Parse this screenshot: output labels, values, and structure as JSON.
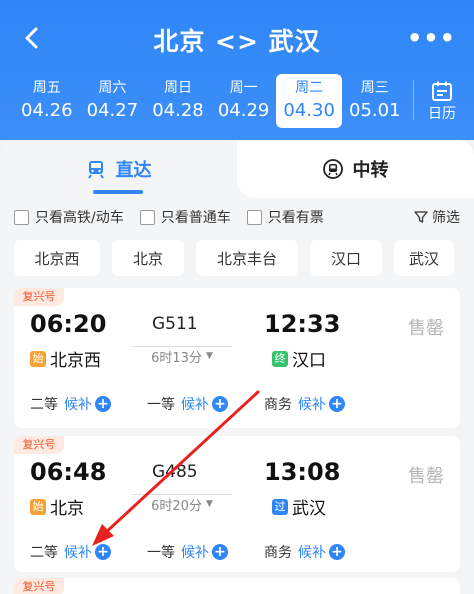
{
  "header": {
    "title": "北京 <> 武汉",
    "more": "•••",
    "calendar_label": "日历",
    "dates": [
      {
        "weekday": "周五",
        "date": "04.26"
      },
      {
        "weekday": "周六",
        "date": "04.27"
      },
      {
        "weekday": "周日",
        "date": "04.28"
      },
      {
        "weekday": "周一",
        "date": "04.29"
      },
      {
        "weekday": "周二",
        "date": "04.30"
      },
      {
        "weekday": "周三",
        "date": "05.01"
      }
    ],
    "active_date_index": 4
  },
  "tabs": {
    "direct": "直达",
    "transfer": "中转"
  },
  "filters": {
    "high_speed": "只看高铁/动车",
    "normal": "只看普通车",
    "available": "只看有票",
    "filter_btn": "筛选"
  },
  "stations": [
    "北京西",
    "北京",
    "北京丰台",
    "汉口",
    "武汉"
  ],
  "trains": [
    {
      "tag": "复兴号",
      "dep_time": "06:20",
      "train_no": "G511",
      "arr_time": "12:33",
      "duration": "6时13分",
      "status": "售罄",
      "dep_badge": "始",
      "dep_station": "北京西",
      "arr_badge": "终",
      "arr_station": "汉口",
      "seats": [
        {
          "name": "二等",
          "status": "候补"
        },
        {
          "name": "一等",
          "status": "候补"
        },
        {
          "name": "商务",
          "status": "候补"
        }
      ]
    },
    {
      "tag": "复兴号",
      "dep_time": "06:48",
      "train_no": "G485",
      "arr_time": "13:08",
      "duration": "6时20分",
      "status": "售罄",
      "dep_badge": "始",
      "dep_station": "北京",
      "arr_badge": "过",
      "arr_station": "武汉",
      "seats": [
        {
          "name": "二等",
          "status": "候补"
        },
        {
          "name": "一等",
          "status": "候补"
        },
        {
          "name": "商务",
          "status": "候补"
        }
      ]
    },
    {
      "tag": "复兴号"
    }
  ],
  "colors": {
    "accent": "#2f86f7",
    "annotation_arrow": "#e8231f"
  }
}
